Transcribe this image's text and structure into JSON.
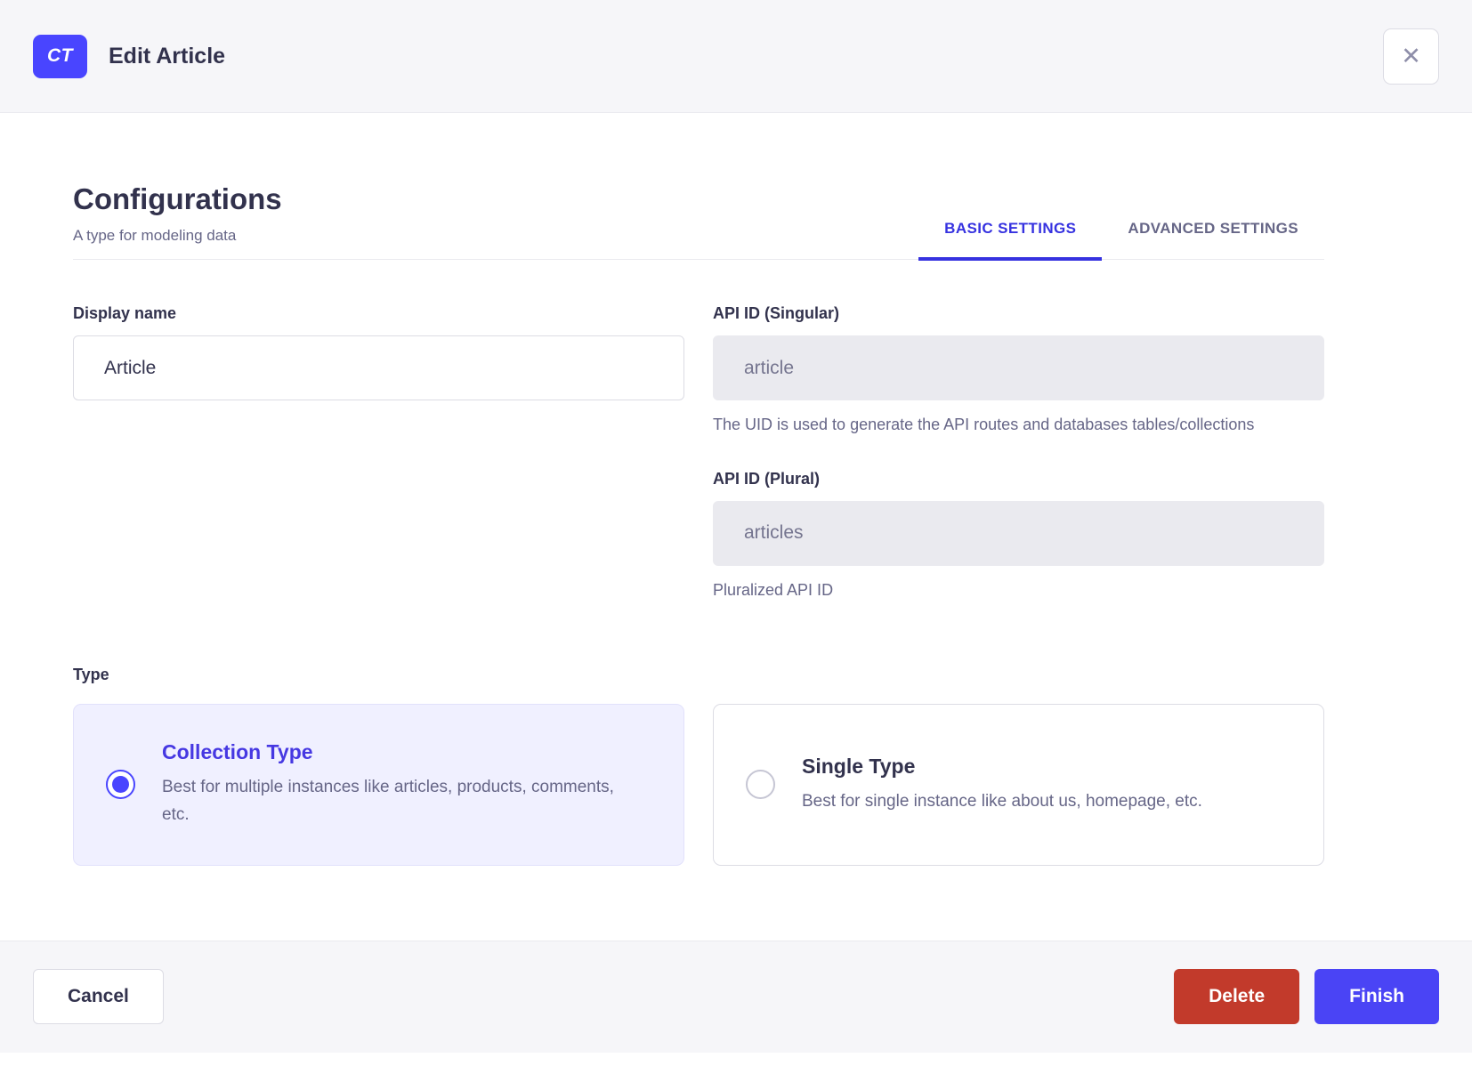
{
  "header": {
    "badge": "CT",
    "title": "Edit Article"
  },
  "icons": {
    "close": "✕"
  },
  "section": {
    "title": "Configurations",
    "subtitle": "A type for modeling data"
  },
  "tabs": [
    {
      "label": "BASIC SETTINGS",
      "active": true
    },
    {
      "label": "ADVANCED SETTINGS",
      "active": false
    }
  ],
  "form": {
    "display_name": {
      "label": "Display name",
      "value": "Article"
    },
    "api_id_singular": {
      "label": "API ID (Singular)",
      "value": "article",
      "hint": "The UID is used to generate the API routes and databases tables/collections"
    },
    "api_id_plural": {
      "label": "API ID (Plural)",
      "value": "articles",
      "hint": "Pluralized API ID"
    },
    "type": {
      "label": "Type",
      "options": [
        {
          "title": "Collection Type",
          "description": "Best for multiple instances like articles, products, comments, etc.",
          "selected": true
        },
        {
          "title": "Single Type",
          "description": "Best for single instance like about us, homepage, etc.",
          "selected": false
        }
      ]
    }
  },
  "footer": {
    "cancel_label": "Cancel",
    "delete_label": "Delete",
    "finish_label": "Finish"
  },
  "colors": {
    "primary": "#4945ff",
    "tab-active": "#3632e0",
    "collection-title": "#4638e2",
    "danger": "#c23a2b",
    "finish": "#4a44f5",
    "text": "#32324d",
    "muted": "#666687",
    "border": "#dcdce4",
    "divider": "#eaeaef",
    "surface": "#f6f6f9",
    "disabled-bg": "#eaeaef",
    "card-selected-bg": "#f0f0ff"
  }
}
